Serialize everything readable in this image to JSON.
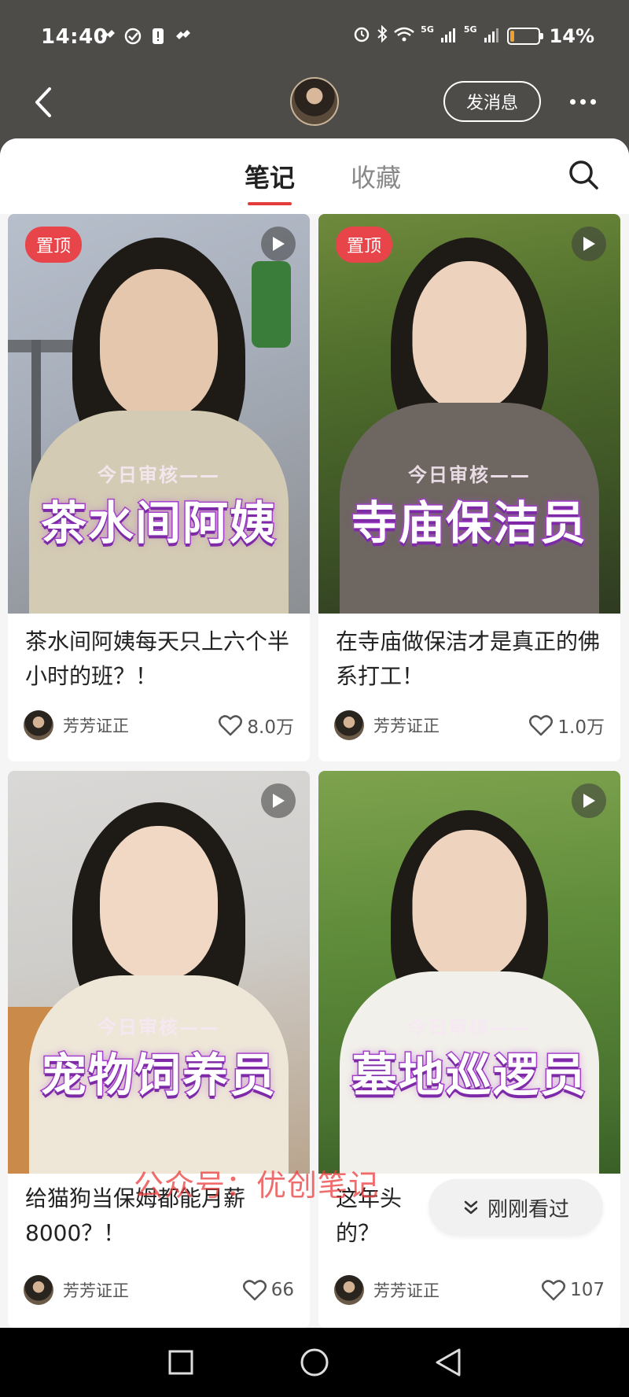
{
  "status_bar": {
    "time": "14:40",
    "network_1": "5G",
    "network_2": "5G",
    "battery_text": "14%",
    "battery_level": 0.14
  },
  "header": {
    "message_button": "发消息"
  },
  "tabs": {
    "notes": "笔记",
    "favorites": "收藏",
    "active": "notes"
  },
  "notes": [
    {
      "pinned_label": "置顶",
      "overlay_sub": "今日审核——",
      "overlay_title": "茶水间阿姨",
      "title": "茶水间阿姨每天只上六个半小时的班？！",
      "author": "芳芳证正",
      "likes": "8.0万",
      "video": true
    },
    {
      "pinned_label": "置顶",
      "overlay_sub": "今日审核——",
      "overlay_title": "寺庙保洁员",
      "title": "在寺庙做保洁才是真正的佛系打工！",
      "author": "芳芳证正",
      "likes": "1.0万",
      "video": true
    },
    {
      "overlay_sub": "今日审核——",
      "overlay_title": "宠物饲养员",
      "title": "给猫狗当保姆都能月薪8000？！",
      "author": "芳芳证正",
      "likes": "66",
      "video": true
    },
    {
      "overlay_sub": "今日审核——",
      "overlay_title": "墓地巡逻员",
      "title": "这年头还…的？",
      "title_line1": "这年头",
      "title_line2": "的？",
      "author": "芳芳证正",
      "likes": "107",
      "video": true
    }
  ],
  "watermark": "公众号：优创笔记",
  "recent_pill": "刚刚看过",
  "colors": {
    "accent": "#e33c3c",
    "pin_bg": "#e8454a",
    "overlay_stroke": "#a23fc8"
  },
  "icons": [
    "back-icon",
    "more-icon",
    "search-icon",
    "play-icon",
    "heart-icon",
    "chevron-down-icon",
    "square-nav-icon",
    "circle-nav-icon",
    "triangle-nav-icon"
  ]
}
